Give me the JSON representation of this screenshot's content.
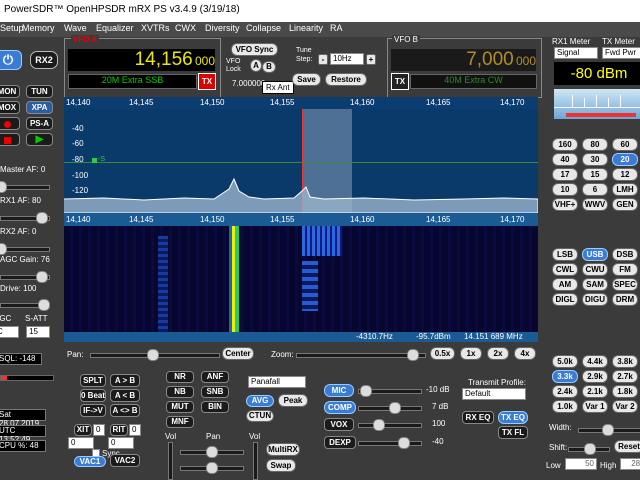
{
  "window": {
    "title": "PowerSDR™ OpenHPSDR mRX PS v3.4.9 (3/19/18)"
  },
  "menu": [
    "Setup",
    "Memory",
    "Wave",
    "Equalizer",
    "XVTRs",
    "CWX",
    "Diversity",
    "Collapse",
    "Linearity",
    "RA"
  ],
  "left": {
    "rx2": "RX2",
    "mon": "MON",
    "tun": "TUN",
    "mox": "MOX",
    "xpa": "XPA",
    "ps_a": "PS-A",
    "master_af": "Master AF:  0",
    "rx1_af": "RX1 AF:  80",
    "rx2_af": "RX2 AF:  0",
    "agc_gain": "AGC Gain:  76",
    "drive": "Drive:  100",
    "agc_label": "AGC",
    "satt_label": "S-ATT",
    "agc_value": "C",
    "satt_value": "15",
    "sql": "SQL:  -148",
    "date": "Sat 28.07.2019",
    "utc": "UTC 13:52:49",
    "cpu": "CPU %:  48"
  },
  "vfoa": {
    "label": "VFO A",
    "freq_main": "14,156",
    "freq_sub": "000",
    "band": "20M Extra SSB",
    "tx": "TX"
  },
  "center": {
    "vfo_sync": "VFO Sync",
    "vfo_lock": "VFO Lock",
    "a": "A",
    "b": "B",
    "tune_step": "Tune Step:",
    "step_value": "10Hz",
    "freq_small": "7.000000",
    "rx_ant": "Rx Ant",
    "save": "Save",
    "restore": "Restore"
  },
  "vfob": {
    "label": "VFO B",
    "freq_main": "7,000",
    "freq_sub": "000",
    "band": "40M Extra CW",
    "tx": "TX"
  },
  "meters": {
    "rx1_meter": "RX1 Meter",
    "tx_meter": "TX Meter",
    "rx_sel": "Signal",
    "tx_sel": "Fwd Pwr",
    "reading": "-80 dBm"
  },
  "panadapter": {
    "freq_ticks": [
      "14,140",
      "14,145",
      "14,150",
      "14,155",
      "14,160",
      "14,165",
      "14,170"
    ],
    "db_ticks": [
      "-40",
      "-60",
      "-80",
      "-100",
      "-120"
    ],
    "marker": "-S",
    "status": [
      "-4310.7Hz",
      "-95.7dBm",
      "14.151 689 MHz"
    ]
  },
  "bands": {
    "rows": [
      [
        "160",
        "80",
        "60"
      ],
      [
        "40",
        "30",
        "20"
      ],
      [
        "17",
        "15",
        "12"
      ],
      [
        "10",
        "6",
        "LMH"
      ],
      [
        "VHF+",
        "WWV",
        "GEN"
      ]
    ],
    "active": "20"
  },
  "modes": {
    "rows": [
      [
        "LSB",
        "USB",
        "DSB"
      ],
      [
        "CWL",
        "CWU",
        "FM"
      ],
      [
        "AM",
        "SAM",
        "SPEC"
      ],
      [
        "DIGL",
        "DIGU",
        "DRM"
      ]
    ],
    "active": "USB"
  },
  "filters": {
    "rows": [
      [
        "5.0k",
        "4.4k",
        "3.8k"
      ],
      [
        "3.3k",
        "2.9k",
        "2.7k"
      ],
      [
        "2.4k",
        "2.1k",
        "1.8k"
      ],
      [
        "1.0k",
        "Var 1",
        "Var 2"
      ]
    ],
    "active": "3.3k",
    "width": "Width:",
    "shift": "Shift:",
    "reset": "Reset",
    "low": "Low",
    "low_val": "50",
    "high": "High",
    "high_val": "2850"
  },
  "bottom": {
    "pan": "Pan:",
    "center": "Center",
    "zoom": "Zoom:",
    "zooms": [
      "0.5x",
      "1x",
      "2x",
      "4x"
    ],
    "splt": "SPLT",
    "a_to_b": "A > B",
    "zero_beat": "0 Beat",
    "a_from_b": "A < B",
    "if_v": "IF->V",
    "a_swap_b": "A <> B",
    "xit": "XIT",
    "xit_val": "0",
    "rit": "RIT",
    "rit_val": "0",
    "spin_a": "0",
    "spin_b": "0",
    "sync": "Sync",
    "vac1": "VAC1",
    "vac2": "VAC2",
    "nr": "NR",
    "anf": "ANF",
    "nb": "NB",
    "snb": "SNB",
    "mut": "MUT",
    "bin": "BIN",
    "mnf": "MNF",
    "display_mode": "Panafall",
    "avg": "AVG",
    "peak": "Peak",
    "ctun": "CTUN",
    "vol": "Vol",
    "pan_lbl": "Pan",
    "multirx": "MultiRX",
    "swap": "Swap",
    "mic": "MIC",
    "mic_val": "-10 dB",
    "comp": "COMP",
    "comp_val": "7 dB",
    "vox": "VOX",
    "vox_val": "100",
    "dexp": "DEXP",
    "dexp_val": "-40",
    "tx_profile": "Transmit Profile:",
    "tx_profile_val": "Default",
    "rx_eq": "RX EQ",
    "tx_eq": "TX EQ",
    "tx_fl": "TX FL"
  },
  "colors": {
    "accent": "#3a7bd5",
    "digits": "#e8e800",
    "band_text": "#00cc00",
    "spectrum_bg": "#0a3a6a"
  }
}
